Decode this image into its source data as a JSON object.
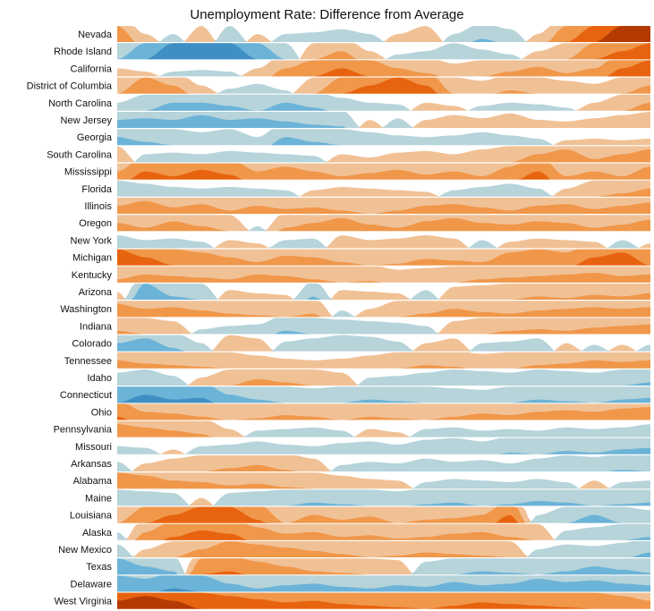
{
  "chart_data": {
    "type": "area",
    "subtype": "horizon",
    "title": "Unemployment Rate: Difference from Average",
    "colors": {
      "neg": [
        "#b6d4da",
        "#6cb3d8",
        "#3f8fc4"
      ],
      "pos": [
        "#f1c196",
        "#f0974a",
        "#e8630f",
        "#b33a03"
      ]
    },
    "states": [
      {
        "name": "Nevada",
        "v": [
          2,
          0.5,
          -0.5,
          1,
          -1,
          0.5,
          -0.5,
          -0.6,
          -0.8,
          -0.5,
          0.5,
          1,
          -0.5,
          -1.2,
          -0.8,
          0.5,
          2,
          3,
          4,
          5.5
        ]
      },
      {
        "name": "Rhode Island",
        "v": [
          -1,
          -2,
          -3,
          -3.5,
          -3,
          -2,
          -1,
          1,
          1.5,
          0.5,
          -0.3,
          -0.5,
          -1,
          -0.6,
          -0.3,
          0.5,
          1,
          2,
          2.5,
          3
        ]
      },
      {
        "name": "California",
        "v": [
          0.5,
          0.3,
          -0.3,
          -0.4,
          -0.3,
          0.5,
          1.5,
          2,
          2.5,
          2,
          1.5,
          1.2,
          0.8,
          1,
          1.3,
          1.6,
          1.2,
          1.5,
          2.5,
          3
        ]
      },
      {
        "name": "District of Columbia",
        "v": [
          1,
          2,
          1.5,
          0.5,
          -0.3,
          -0.6,
          -0.2,
          1,
          2,
          2.5,
          3,
          2.5,
          1,
          0.8,
          1.2,
          1,
          0.8,
          0.6,
          1,
          1.5
        ]
      },
      {
        "name": "North Carolina",
        "v": [
          -0.5,
          -1,
          -1.5,
          -1.5,
          -1.3,
          -1,
          -1.5,
          -1.2,
          -0.8,
          -0.5,
          -0.4,
          0.5,
          0.3,
          -0.3,
          -0.5,
          -0.4,
          -0.2,
          0.5,
          1,
          1.5
        ]
      },
      {
        "name": "New Jersey",
        "v": [
          -1.5,
          -1.6,
          -1.5,
          -1.8,
          -1.5,
          -1.6,
          -1.4,
          -1.2,
          -1.1,
          0.5,
          -0.6,
          0.5,
          0.8,
          0.6,
          0.9,
          0.5,
          0.4,
          0.6,
          0.8,
          1
        ]
      },
      {
        "name": "Georgia",
        "v": [
          -1.5,
          -1.2,
          -1,
          -0.8,
          -1,
          -0.5,
          -1.5,
          -1.2,
          -1,
          -0.8,
          -0.6,
          -0.5,
          -0.6,
          -0.8,
          -0.6,
          -0.4,
          0.3,
          0.4,
          0.3,
          0.4
        ]
      },
      {
        "name": "South Carolina",
        "v": [
          1,
          -0.5,
          -0.6,
          -0.5,
          -0.7,
          -0.6,
          -0.5,
          -0.4,
          0.5,
          0.3,
          0.6,
          0.7,
          0.5,
          0.8,
          1,
          1.5,
          1.8,
          1.2,
          1.5,
          1.8
        ]
      },
      {
        "name": "Mississippi",
        "v": [
          1.5,
          2.5,
          2.2,
          2.6,
          2.3,
          1.5,
          1.8,
          1.5,
          1.2,
          1.4,
          1.6,
          1.3,
          1.5,
          1.2,
          1.8,
          2.5,
          1.2,
          1.5,
          1.2,
          1.8
        ]
      },
      {
        "name": "Florida",
        "v": [
          -1,
          -0.8,
          -0.6,
          -0.5,
          -0.6,
          -0.5,
          -0.4,
          0.4,
          0.6,
          0.5,
          0.4,
          0.3,
          -0.4,
          -0.6,
          -0.8,
          -0.5,
          0.5,
          1,
          1.2,
          1.5
        ]
      },
      {
        "name": "Illinois",
        "v": [
          1.5,
          1.8,
          1.4,
          1.6,
          1.2,
          1.5,
          1.3,
          1.4,
          1.2,
          1,
          1.2,
          1.5,
          1.6,
          1.4,
          1.2,
          1.5,
          1.6,
          1.3,
          1.5,
          1.7
        ]
      },
      {
        "name": "Oregon",
        "v": [
          1.5,
          1.2,
          1.6,
          1.3,
          1,
          -0.3,
          1.2,
          1.5,
          1.8,
          1.4,
          1.2,
          1.6,
          1.8,
          1.5,
          1.4,
          1.6,
          1.5,
          1.2,
          1.4,
          1.7
        ]
      },
      {
        "name": "New York",
        "v": [
          -0.8,
          -0.5,
          -0.6,
          -0.4,
          0.5,
          0.3,
          -0.5,
          -0.6,
          0.8,
          0.5,
          0.6,
          0.8,
          0.6,
          -0.5,
          0.4,
          0.6,
          0.5,
          0.4,
          -0.5,
          0.3
        ]
      },
      {
        "name": "Michigan",
        "v": [
          3,
          2.5,
          2,
          1.8,
          1.5,
          1.2,
          1.6,
          1.5,
          1.2,
          1,
          1.1,
          1.4,
          1.3,
          1.2,
          1.8,
          2,
          1.8,
          2.5,
          2.8,
          2
        ]
      },
      {
        "name": "Kentucky",
        "v": [
          1.2,
          1.5,
          1.4,
          1.3,
          1.2,
          1.5,
          1.4,
          1.2,
          1,
          1.1,
          0.8,
          0.9,
          1,
          1.2,
          1.3,
          1.4,
          1.5,
          1.6,
          1.4,
          1.5
        ]
      },
      {
        "name": "Arizona",
        "v": [
          0.5,
          -2,
          -1.2,
          -1,
          0.6,
          0.4,
          0.3,
          -1.2,
          0.6,
          0.5,
          0.4,
          -0.6,
          0.8,
          0.9,
          1,
          1.2,
          1.1,
          1.3,
          1.2,
          1.4
        ]
      },
      {
        "name": "Washington",
        "v": [
          1.8,
          1.5,
          1.6,
          1.4,
          1.2,
          1.1,
          1,
          1.2,
          -0.4,
          0.5,
          1,
          1.2,
          1.5,
          1.3,
          1.2,
          1.4,
          1.5,
          1.6,
          1.5,
          1.6
        ]
      },
      {
        "name": "Indiana",
        "v": [
          1.2,
          1,
          0.8,
          -0.3,
          -0.5,
          -0.6,
          -1.2,
          -1,
          -0.9,
          -0.8,
          -0.7,
          -0.5,
          0.8,
          1,
          1.2,
          1.3,
          1.2,
          1.4,
          1.5,
          1.6
        ]
      },
      {
        "name": "Colorado",
        "v": [
          -1.5,
          -1.8,
          -1.2,
          -0.5,
          1,
          0.8,
          -0.6,
          -0.8,
          -1,
          -0.9,
          -0.6,
          0.5,
          0.8,
          -0.5,
          -0.6,
          -0.8,
          0.5,
          -0.4,
          0.4,
          -0.4
        ]
      },
      {
        "name": "Tennessee",
        "v": [
          1.5,
          1.3,
          1.2,
          1.1,
          1,
          0.8,
          0.6,
          0.5,
          0.6,
          0.8,
          1,
          1.2,
          1.1,
          0.9,
          1,
          1.2,
          1.3,
          1.5,
          1.4,
          1.5
        ]
      },
      {
        "name": "Idaho",
        "v": [
          -0.8,
          -1,
          -0.6,
          0.5,
          1,
          1.4,
          1.2,
          1,
          0.8,
          -0.5,
          -0.6,
          -0.8,
          -1,
          -0.9,
          -0.8,
          -1,
          -0.9,
          -0.8,
          -1,
          -1.2
        ]
      },
      {
        "name": "Connecticut",
        "v": [
          -2,
          -2.5,
          -2.2,
          -2.3,
          -1.5,
          -1.2,
          -1,
          -0.9,
          -1,
          -1.2,
          -1.1,
          -1,
          -0.9,
          -0.8,
          -1,
          -1.2,
          -1.1,
          -1,
          -1.2,
          -1.3
        ]
      },
      {
        "name": "Ohio",
        "v": [
          2.2,
          1.5,
          1.4,
          1.2,
          1,
          1.1,
          1.3,
          1.2,
          1,
          1.2,
          1.1,
          1,
          1.2,
          1.4,
          1.3,
          1.5,
          1.6,
          1.5,
          1.7,
          1.8
        ]
      },
      {
        "name": "Pennsylvania",
        "v": [
          1.8,
          1.6,
          1.4,
          1.2,
          0.5,
          -0.4,
          -0.5,
          -0.6,
          -0.4,
          0.5,
          0.3,
          -0.5,
          -0.6,
          -0.4,
          -0.5,
          -0.4,
          -0.6,
          -0.5,
          -0.6,
          -0.8
        ]
      },
      {
        "name": "Missouri",
        "v": [
          -0.5,
          -0.4,
          0.3,
          -0.5,
          -0.6,
          -0.8,
          -0.6,
          -0.5,
          -0.7,
          -0.8,
          -0.6,
          -0.9,
          -1,
          -0.8,
          -1.1,
          -1,
          -1.2,
          -1.1,
          -1.3,
          -1.4
        ]
      },
      {
        "name": "Arkansas",
        "v": [
          -0.6,
          0.5,
          0.8,
          1,
          1.2,
          1.4,
          1.1,
          0.8,
          -0.4,
          -0.6,
          -0.5,
          -0.8,
          -0.6,
          -0.7,
          -0.5,
          -0.8,
          -1,
          -0.9,
          -1.1,
          -1
        ]
      },
      {
        "name": "Alabama",
        "v": [
          2,
          1.8,
          1.5,
          1.4,
          1.2,
          1.3,
          1.1,
          1,
          0.8,
          0.6,
          0.5,
          -0.4,
          -0.6,
          -0.5,
          -0.4,
          -0.6,
          -0.4,
          0.5,
          -0.4,
          -0.5
        ]
      },
      {
        "name": "Maine",
        "v": [
          -1,
          -0.9,
          -0.8,
          0.5,
          -0.8,
          -0.9,
          -1,
          -1.2,
          -1.1,
          -1,
          -0.9,
          -1.1,
          -1.2,
          -1,
          -1.1,
          -1.3,
          -1.2,
          -1,
          -1.1,
          -1.2
        ]
      },
      {
        "name": "Louisiana",
        "v": [
          1,
          2,
          2.5,
          3,
          3,
          2.2,
          1,
          1.5,
          1.2,
          1.4,
          1,
          1.2,
          1.3,
          1.5,
          2.5,
          -0.5,
          -1,
          -1.5,
          -1,
          -0.8
        ]
      },
      {
        "name": "Alaska",
        "v": [
          -0.5,
          1.5,
          2.2,
          2.6,
          2.4,
          1.8,
          1.4,
          1.5,
          1.2,
          1.3,
          1.1,
          1.2,
          1.4,
          1.5,
          1.2,
          1,
          -0.6,
          -0.8,
          -1,
          -1.2
        ]
      },
      {
        "name": "New Mexico",
        "v": [
          -0.8,
          0.5,
          1,
          1.5,
          2,
          1.8,
          1.6,
          1.4,
          1.2,
          1,
          1.1,
          1.3,
          1.2,
          1.1,
          1,
          -0.5,
          -0.8,
          -0.7,
          -0.9,
          -1.3
        ]
      },
      {
        "name": "Texas",
        "v": [
          -2,
          -1.5,
          -1.2,
          2,
          2.2,
          1.8,
          1.5,
          1.2,
          1.1,
          1,
          0.9,
          -0.8,
          -1,
          -1.2,
          -1.1,
          -1,
          -1.2,
          -1.5,
          -1.3,
          -1.1
        ]
      },
      {
        "name": "Delaware",
        "v": [
          -2,
          -1.8,
          -2.2,
          -2,
          -1.5,
          -1.2,
          -1.4,
          -1.5,
          -1.3,
          -1.2,
          -1.4,
          -1.3,
          -1.6,
          -1.4,
          -1.5,
          -1.8,
          -1.6,
          -1.7,
          -1.5,
          -1.4
        ]
      },
      {
        "name": "West Virginia",
        "v": [
          3.5,
          3.8,
          3.5,
          3,
          2.8,
          2.6,
          2.4,
          2.5,
          2.3,
          2.2,
          2.1,
          2,
          2.2,
          2.4,
          2.3,
          2.2,
          2.1,
          2,
          1.8,
          1.5
        ]
      }
    ],
    "band_size": 1,
    "xlabel": "",
    "ylabel": ""
  }
}
